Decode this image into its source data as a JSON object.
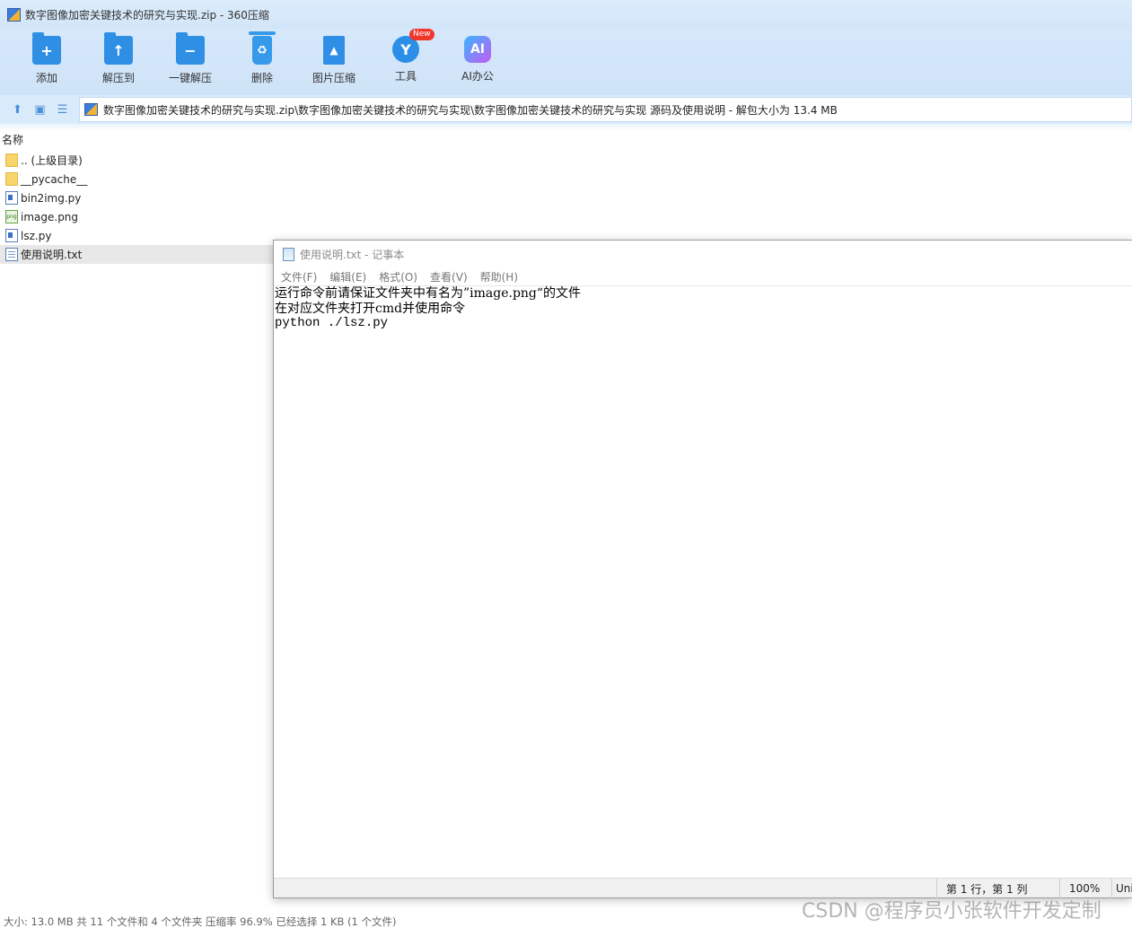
{
  "app": {
    "title": "数字图像加密关键技术的研究与实现.zip - 360压缩"
  },
  "toolbar": {
    "items": [
      {
        "label": "添加",
        "icon": "add-icon",
        "glyph": "+"
      },
      {
        "label": "解压到",
        "icon": "extract-to-icon",
        "glyph": "↑"
      },
      {
        "label": "一键解压",
        "icon": "one-click-extract-icon",
        "glyph": "−"
      },
      {
        "label": "删除",
        "icon": "delete-icon",
        "glyph": "♻"
      },
      {
        "label": "图片压缩",
        "icon": "image-compress-icon",
        "glyph": "▲"
      },
      {
        "label": "工具",
        "icon": "tools-icon",
        "glyph": "Y",
        "badge": "New"
      },
      {
        "label": "AI办公",
        "icon": "ai-office-icon",
        "glyph": "AI"
      }
    ]
  },
  "navigation": {
    "path": "数字图像加密关键技术的研究与实现.zip\\数字图像加密关键技术的研究与实现\\数字图像加密关键技术的研究与实现 源码及使用说明 - 解包大小为 13.4 MB"
  },
  "file_list": {
    "column_name": "名称",
    "items": [
      {
        "name": ".. (上级目录)",
        "type": "folder"
      },
      {
        "name": "__pycache__",
        "type": "folder"
      },
      {
        "name": "bin2img.py",
        "type": "py"
      },
      {
        "name": "image.png",
        "type": "png"
      },
      {
        "name": "lsz.py",
        "type": "py"
      },
      {
        "name": "使用说明.txt",
        "type": "txt",
        "selected": true
      }
    ]
  },
  "status": {
    "text": "大小: 13.0 MB 共 11 个文件和 4 个文件夹 压缩率 96.9% 已经选择 1 KB (1 个文件)"
  },
  "watermark": "CSDN @程序员小张软件开发定制",
  "notepad": {
    "title": "使用说明.txt - 记事本",
    "menu": [
      "文件(F)",
      "编辑(E)",
      "格式(O)",
      "查看(V)",
      "帮助(H)"
    ],
    "lines": [
      "运行命令前请保证文件夹中有名为”image.png“的文件",
      "在对应文件夹打开cmd并使用命令",
      "python ./lsz.py"
    ],
    "status": {
      "position": "第 1 行，第 1 列",
      "zoom": "100%",
      "encoding": "Unicode"
    }
  }
}
